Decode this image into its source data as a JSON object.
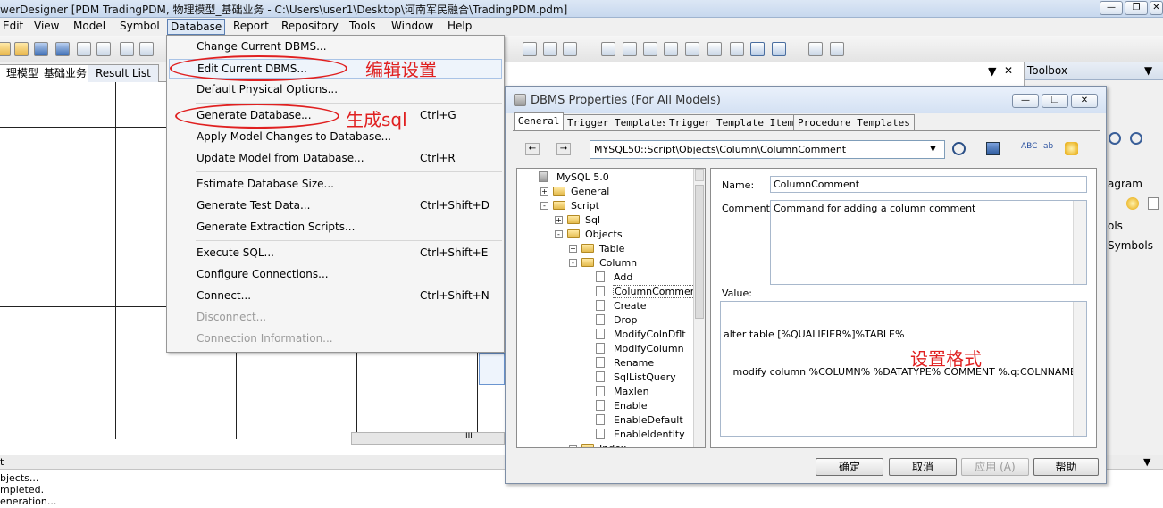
{
  "window": {
    "title": "werDesigner [PDM TradingPDM, 物理模型_基础业务 - C:\\Users\\user1\\Desktop\\河南军民融合\\TradingPDM.pdm]",
    "min_label": "—",
    "max_label": "❐",
    "close_label": "✕"
  },
  "menubar": [
    "Edit",
    "View",
    "Model",
    "Symbol",
    "Database",
    "Report",
    "Repository",
    "Tools",
    "Window",
    "Help"
  ],
  "tabs": {
    "model_tab": "理模型_基础业务",
    "result_tab": "Result List",
    "pin": "▼",
    "close": "✕"
  },
  "database_menu": {
    "items": [
      {
        "label": "Change Current DBMS...",
        "shortcut": "",
        "enabled": true
      },
      {
        "label": "Edit Current DBMS...",
        "shortcut": "",
        "enabled": true
      },
      {
        "label": "Default Physical Options...",
        "shortcut": "",
        "enabled": true
      },
      {
        "label": "Generate Database...",
        "shortcut": "Ctrl+G",
        "enabled": true
      },
      {
        "label": "Apply Model Changes to Database...",
        "shortcut": "",
        "enabled": true
      },
      {
        "label": "Update Model from Database...",
        "shortcut": "Ctrl+R",
        "enabled": true
      },
      {
        "label": "Estimate Database Size...",
        "shortcut": "",
        "enabled": true
      },
      {
        "label": "Generate Test Data...",
        "shortcut": "Ctrl+Shift+D",
        "enabled": true
      },
      {
        "label": "Generate Extraction Scripts...",
        "shortcut": "",
        "enabled": true
      },
      {
        "label": "Execute SQL...",
        "shortcut": "Ctrl+Shift+E",
        "enabled": true
      },
      {
        "label": "Configure Connections...",
        "shortcut": "",
        "enabled": true
      },
      {
        "label": "Connect...",
        "shortcut": "Ctrl+Shift+N",
        "enabled": true
      },
      {
        "label": "Disconnect...",
        "shortcut": "",
        "enabled": false
      },
      {
        "label": "Connection Information...",
        "shortcut": "",
        "enabled": false
      }
    ]
  },
  "annotations": {
    "edit_dbms": "编辑设置",
    "generate_sql": "生成sql",
    "format": "设置格式"
  },
  "toolbox": {
    "title": "Toolbox",
    "pin": "▼",
    "items": [
      "agram",
      "ols",
      "Symbols"
    ]
  },
  "output": {
    "header": "t",
    "pin": "▼",
    "lines": [
      "bjects...",
      "mpleted.",
      "eneration..."
    ]
  },
  "dialog": {
    "title": "DBMS Properties (For All Models)",
    "tabs": [
      "General",
      "Trigger Templates",
      "Trigger Template Items",
      "Procedure Templates"
    ],
    "active_tab": "General",
    "path": "MYSQL50::Script\\Objects\\Column\\ColumnComment",
    "tree": [
      {
        "label": "MySQL 5.0",
        "level": 0,
        "type": "root",
        "exp": ""
      },
      {
        "label": "General",
        "level": 1,
        "type": "folder",
        "exp": "+"
      },
      {
        "label": "Script",
        "level": 1,
        "type": "folder",
        "exp": "-"
      },
      {
        "label": "Sql",
        "level": 2,
        "type": "folder",
        "exp": "+"
      },
      {
        "label": "Objects",
        "level": 2,
        "type": "folder",
        "exp": "-"
      },
      {
        "label": "Table",
        "level": 3,
        "type": "folder",
        "exp": "+"
      },
      {
        "label": "Column",
        "level": 3,
        "type": "folder",
        "exp": "-"
      },
      {
        "label": "Add",
        "level": 4,
        "type": "doc",
        "exp": ""
      },
      {
        "label": "ColumnComment",
        "level": 4,
        "type": "doc",
        "exp": "",
        "selected": true
      },
      {
        "label": "Create",
        "level": 4,
        "type": "doc",
        "exp": ""
      },
      {
        "label": "Drop",
        "level": 4,
        "type": "doc",
        "exp": ""
      },
      {
        "label": "ModifyColnDflt",
        "level": 4,
        "type": "doc",
        "exp": ""
      },
      {
        "label": "ModifyColumn",
        "level": 4,
        "type": "doc",
        "exp": ""
      },
      {
        "label": "Rename",
        "level": 4,
        "type": "doc",
        "exp": ""
      },
      {
        "label": "SqlListQuery",
        "level": 4,
        "type": "doc",
        "exp": ""
      },
      {
        "label": "Maxlen",
        "level": 4,
        "type": "doc",
        "exp": ""
      },
      {
        "label": "Enable",
        "level": 4,
        "type": "doc",
        "exp": ""
      },
      {
        "label": "EnableDefault",
        "level": 4,
        "type": "doc",
        "exp": ""
      },
      {
        "label": "EnableIdentity",
        "level": 4,
        "type": "doc",
        "exp": ""
      },
      {
        "label": "Index",
        "level": 3,
        "type": "folder",
        "exp": "+"
      }
    ],
    "name_label": "Name:",
    "name_value": "ColumnComment",
    "comment_label": "Comment:",
    "comment_value": "Command for adding a column comment",
    "value_label": "Value:",
    "value_line1": "alter table [%QUALIFIER%]%TABLE%",
    "value_line2": "   modify column %COLUMN% %DATATYPE% COMMENT %.q:COLNNAME%",
    "buttons": {
      "ok": "确定",
      "cancel": "取消",
      "apply": "应用 (A)",
      "help": "帮助"
    }
  },
  "colors": {
    "annotation": "#e02020",
    "selection": "#3a6ea5"
  }
}
